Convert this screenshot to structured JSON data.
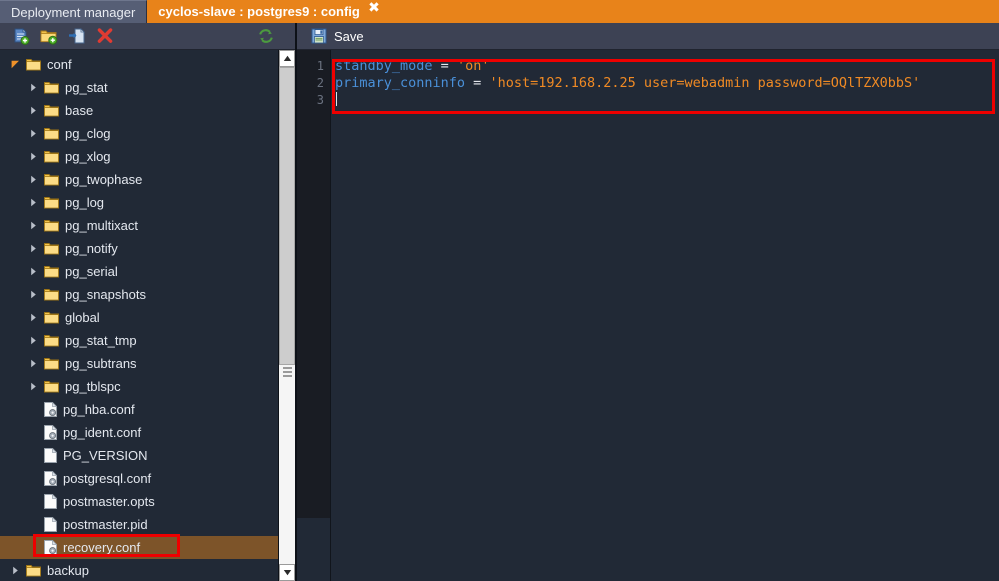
{
  "tabs": [
    {
      "label": "Deployment manager",
      "active": false,
      "closable": false
    },
    {
      "label": "cyclos-slave : postgres9 : config",
      "active": true,
      "closable": true,
      "close_glyph": "✖"
    }
  ],
  "file_toolbar": {
    "buttons": [
      {
        "name": "new-file-icon",
        "tooltip": "New file"
      },
      {
        "name": "new-folder-icon",
        "tooltip": "New folder"
      },
      {
        "name": "upload-file-icon",
        "tooltip": "Upload file"
      },
      {
        "name": "delete-icon",
        "tooltip": "Delete"
      }
    ],
    "refresh": {
      "name": "refresh-icon",
      "tooltip": "Refresh"
    }
  },
  "editor_toolbar": {
    "save_label": "Save"
  },
  "tree": {
    "items": [
      {
        "label": "conf",
        "type": "folder",
        "depth": 0,
        "expanded": true,
        "selected": false
      },
      {
        "label": "pg_stat",
        "type": "folder",
        "depth": 1,
        "expanded": false,
        "selected": false
      },
      {
        "label": "base",
        "type": "folder",
        "depth": 1,
        "expanded": false,
        "selected": false
      },
      {
        "label": "pg_clog",
        "type": "folder",
        "depth": 1,
        "expanded": false,
        "selected": false
      },
      {
        "label": "pg_xlog",
        "type": "folder",
        "depth": 1,
        "expanded": false,
        "selected": false
      },
      {
        "label": "pg_twophase",
        "type": "folder",
        "depth": 1,
        "expanded": false,
        "selected": false
      },
      {
        "label": "pg_log",
        "type": "folder",
        "depth": 1,
        "expanded": false,
        "selected": false
      },
      {
        "label": "pg_multixact",
        "type": "folder",
        "depth": 1,
        "expanded": false,
        "selected": false
      },
      {
        "label": "pg_notify",
        "type": "folder",
        "depth": 1,
        "expanded": false,
        "selected": false
      },
      {
        "label": "pg_serial",
        "type": "folder",
        "depth": 1,
        "expanded": false,
        "selected": false
      },
      {
        "label": "pg_snapshots",
        "type": "folder",
        "depth": 1,
        "expanded": false,
        "selected": false
      },
      {
        "label": "global",
        "type": "folder",
        "depth": 1,
        "expanded": false,
        "selected": false
      },
      {
        "label": "pg_stat_tmp",
        "type": "folder",
        "depth": 1,
        "expanded": false,
        "selected": false
      },
      {
        "label": "pg_subtrans",
        "type": "folder",
        "depth": 1,
        "expanded": false,
        "selected": false
      },
      {
        "label": "pg_tblspc",
        "type": "folder",
        "depth": 1,
        "expanded": false,
        "selected": false
      },
      {
        "label": "pg_hba.conf",
        "type": "config",
        "depth": 1,
        "expanded": false,
        "selected": false
      },
      {
        "label": "pg_ident.conf",
        "type": "config",
        "depth": 1,
        "expanded": false,
        "selected": false
      },
      {
        "label": "PG_VERSION",
        "type": "file",
        "depth": 1,
        "expanded": false,
        "selected": false
      },
      {
        "label": "postgresql.conf",
        "type": "config",
        "depth": 1,
        "expanded": false,
        "selected": false
      },
      {
        "label": "postmaster.opts",
        "type": "file",
        "depth": 1,
        "expanded": false,
        "selected": false
      },
      {
        "label": "postmaster.pid",
        "type": "file",
        "depth": 1,
        "expanded": false,
        "selected": false
      },
      {
        "label": "recovery.conf",
        "type": "config",
        "depth": 1,
        "expanded": false,
        "selected": true
      },
      {
        "label": "backup",
        "type": "folder",
        "depth": 0,
        "expanded": false,
        "selected": false
      }
    ]
  },
  "code": {
    "line_numbers": [
      "1",
      "2",
      "3"
    ],
    "lines": [
      {
        "key": "standby_mode",
        "op": " = ",
        "value": "'on'"
      },
      {
        "key": "primary_conninfo",
        "op": " = ",
        "value": "'host=192.168.2.25 user=webadmin password=OQlTZX0bbS'"
      },
      {
        "key": "",
        "op": "",
        "value": ""
      }
    ]
  },
  "colors": {
    "tab_active": "#e8831a",
    "tab_inactive": "#565e75",
    "toolbar": "#3d4254",
    "editor_bg": "#212936",
    "gutter_bg": "#191c23",
    "selection": "#7d5429",
    "annotation": "#ee0000",
    "code_key": "#4a90d9",
    "code_string": "#f08a24"
  }
}
